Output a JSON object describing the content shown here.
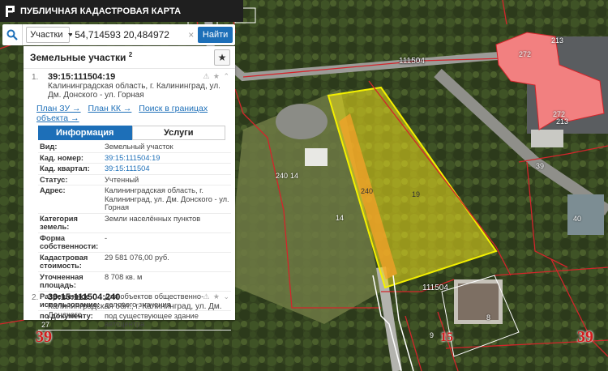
{
  "app": {
    "title": "ПУБЛИЧНАЯ КАДАСТРОВАЯ КАРТА"
  },
  "search": {
    "type_select": "Участки",
    "query": "54,714593 20,484972",
    "find_label": "Найти"
  },
  "panel": {
    "title": "Земельные участки",
    "count": "2",
    "item1": {
      "num": "1.",
      "id": "39:15:111504:19",
      "address": "Калининградская область, г. Калининград, ул. Дм. Донского - ул. Горная",
      "links": [
        "План ЗУ →",
        "План КК →",
        "Поиск в границах объекта →"
      ],
      "tabs": [
        "Информация",
        "Услуги"
      ],
      "rows": [
        {
          "k": "Вид:",
          "v": "Земельный участок"
        },
        {
          "k": "Кад. номер:",
          "v": "39:15:111504:19"
        },
        {
          "k": "Кад. квартал:",
          "v": "39:15:111504"
        },
        {
          "k": "Статус:",
          "v": "Учтенный"
        },
        {
          "k": "Адрес:",
          "v": "Калининградская область, г. Калининград, ул. Дм. Донского - ул. Горная"
        },
        {
          "k": "Категория земель:",
          "v": "Земли населённых пунктов"
        },
        {
          "k": "Форма собственности:",
          "v": "-"
        },
        {
          "k": "Кадастровая стоимость:",
          "v": "29 581 076,00 руб."
        },
        {
          "k": "Уточненная площадь:",
          "v": "8 708 кв. м"
        },
        {
          "k": "Разрешенное использование:",
          "v": "Для объектов общественно-делового значения"
        },
        {
          "k": "по документу:",
          "v": "под существующее здание автоцентра"
        }
      ]
    },
    "item2": {
      "num": "2.",
      "id": "39:15:111504:240",
      "address": "Калининградская обл., г. Калининград, ул. Дм. Донского"
    }
  },
  "map": {
    "labels": {
      "q111504_top": "111504",
      "q111504_bottom": "111504",
      "n213_a": "213",
      "n272_a": "272",
      "n272_b": "272",
      "n213_b": "213",
      "n39_small": "39",
      "n40": "40",
      "n240_left": "240",
      "n14_a": "14",
      "n14_b": "14",
      "n240_orange": "240",
      "n19": "19",
      "n8": "8",
      "n9": "9",
      "n27": "27",
      "n39_big_left": "39",
      "n15_big": "15",
      "n39_big_right": "39"
    },
    "colors": {
      "parcel_fill": "#f0e21e",
      "parcel_stroke": "#f3f000",
      "orange": "#f6a22a",
      "boundary": "#d3252b",
      "building": "#f28080"
    }
  }
}
